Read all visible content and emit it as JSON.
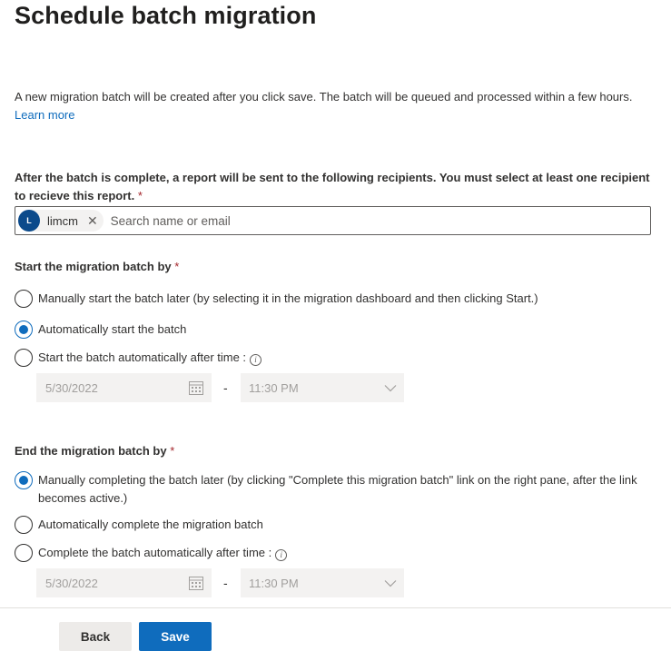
{
  "page": {
    "title": "Schedule batch migration"
  },
  "intro": {
    "text": "A new migration batch will be created after you click save. The batch will be queued and processed within a few hours. ",
    "link": "Learn more"
  },
  "recipients": {
    "label": "After the batch is complete, a report will be sent to the following recipients. You must select at least one recipient to recieve this report.",
    "required": " *",
    "persona": {
      "initial": "L",
      "name": "limcm"
    },
    "remove_glyph": "✕",
    "placeholder": "Search name or email"
  },
  "start": {
    "label": "Start the migration batch by",
    "required": " *",
    "options": [
      {
        "label": "Manually start the batch later (by selecting it in the migration dashboard and then clicking Start.)",
        "checked": false
      },
      {
        "label": "Automatically start the batch",
        "checked": true
      },
      {
        "label": "Start the batch automatically after time :",
        "checked": false
      }
    ],
    "date": "5/30/2022",
    "dash": "-",
    "time": "11:30 PM"
  },
  "end": {
    "label": "End the migration batch by",
    "required": " *",
    "options": [
      {
        "label": "Manually completing the batch later (by clicking \"Complete this migration batch\" link on the right pane, after the link becomes active.)",
        "checked": true
      },
      {
        "label": "Automatically complete the migration batch",
        "checked": false
      },
      {
        "label": "Complete the batch automatically after time :",
        "checked": false
      }
    ],
    "date": "5/30/2022",
    "dash": "-",
    "time": "11:30 PM"
  },
  "info_glyph": "i",
  "footer": {
    "back_label": "Back",
    "save_label": "Save"
  },
  "colors": {
    "accent": "#0f6cbd",
    "required": "#a4262c",
    "avatar": "#0b4a8b"
  }
}
